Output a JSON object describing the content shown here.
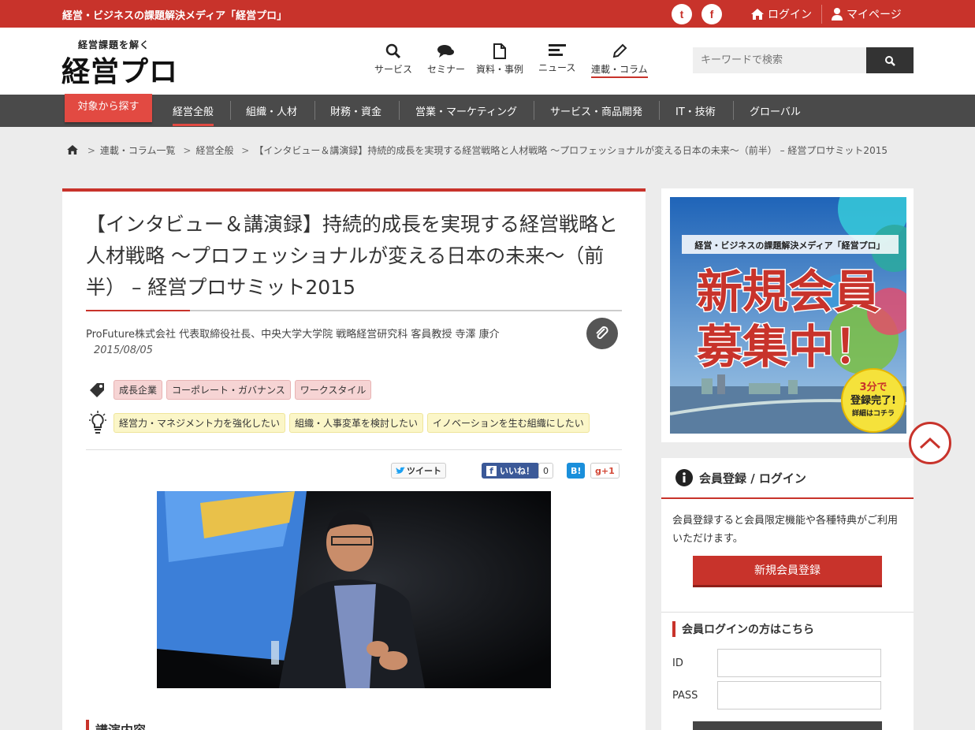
{
  "topbar": {
    "tagline": "経営・ビジネスの課題解決メディア「経営プロ」",
    "twitter": "twitter-icon",
    "facebook": "facebook-icon",
    "login": "ログイン",
    "mypage": "マイページ"
  },
  "logo": {
    "sub": "経営課題を解く",
    "main": "経営プロ"
  },
  "nav": [
    {
      "label": "サービス",
      "icon": "search-icon"
    },
    {
      "label": "セミナー",
      "icon": "chat-icon"
    },
    {
      "label": "資料・事例",
      "icon": "document-icon"
    },
    {
      "label": "ニュース",
      "icon": "news-icon"
    },
    {
      "label": "連載・コラム",
      "icon": "pencil-icon",
      "active": true
    }
  ],
  "search": {
    "placeholder": "キーワードで検索"
  },
  "categories": {
    "button": "対象から探す",
    "items": [
      "経営全般",
      "組織・人材",
      "財務・資金",
      "営業・マーケティング",
      "サービス・商品開発",
      "IT・技術",
      "グローバル"
    ],
    "active": "経営全般"
  },
  "breadcrumb": [
    "連載・コラム一覧",
    "経営全般",
    "【インタビュー＆講演録】持続的成長を実現する経営戦略と人材戦略 〜プロフェッショナルが変える日本の未来〜（前半） – 経営プロサミット2015"
  ],
  "article": {
    "title": "【インタビュー＆講演録】持続的成長を実現する経営戦略と人材戦略 〜プロフェッショナルが変える日本の未来〜（前半） – 経営プロサミット2015",
    "author": "ProFuture株式会社 代表取締役社長、中央大学大学院 戦略経営研究科 客員教授 寺澤 康介",
    "date": "2015/08/05",
    "tags": [
      "成長企業",
      "コーポレート・ガバナンス",
      "ワークスタイル"
    ],
    "themes": [
      "経営力・マネジメント力を強化したい",
      "組織・人事変革を検討したい",
      "イノベーションを生む組織にしたい"
    ],
    "section": "講演内容"
  },
  "share": {
    "tweet": "ツイート",
    "like": "いいね！",
    "like_count": "0",
    "hatena": "B!",
    "gplus": "g+1"
  },
  "banner": {
    "media": "経営・ビジネスの課題解決メディア「経営プロ」",
    "headline1": "新規会員",
    "headline2": "募集中！",
    "badge1": "3分で",
    "badge2": "登録完了!",
    "badge3": "詳細はコチラ"
  },
  "member": {
    "title": "会員登録 / ログイン",
    "text": "会員登録すると会員限定機能や各種特典がご利用いただけます。",
    "register": "新規会員登録",
    "login_title": "会員ログインの方はこちら",
    "id_label": "ID",
    "pass_label": "PASS"
  },
  "colors": {
    "brand": "#c8332b",
    "catbar": "#4a4a4a",
    "tag_pink": "#f6d4d4",
    "tag_yellow": "#fbf6c8"
  }
}
